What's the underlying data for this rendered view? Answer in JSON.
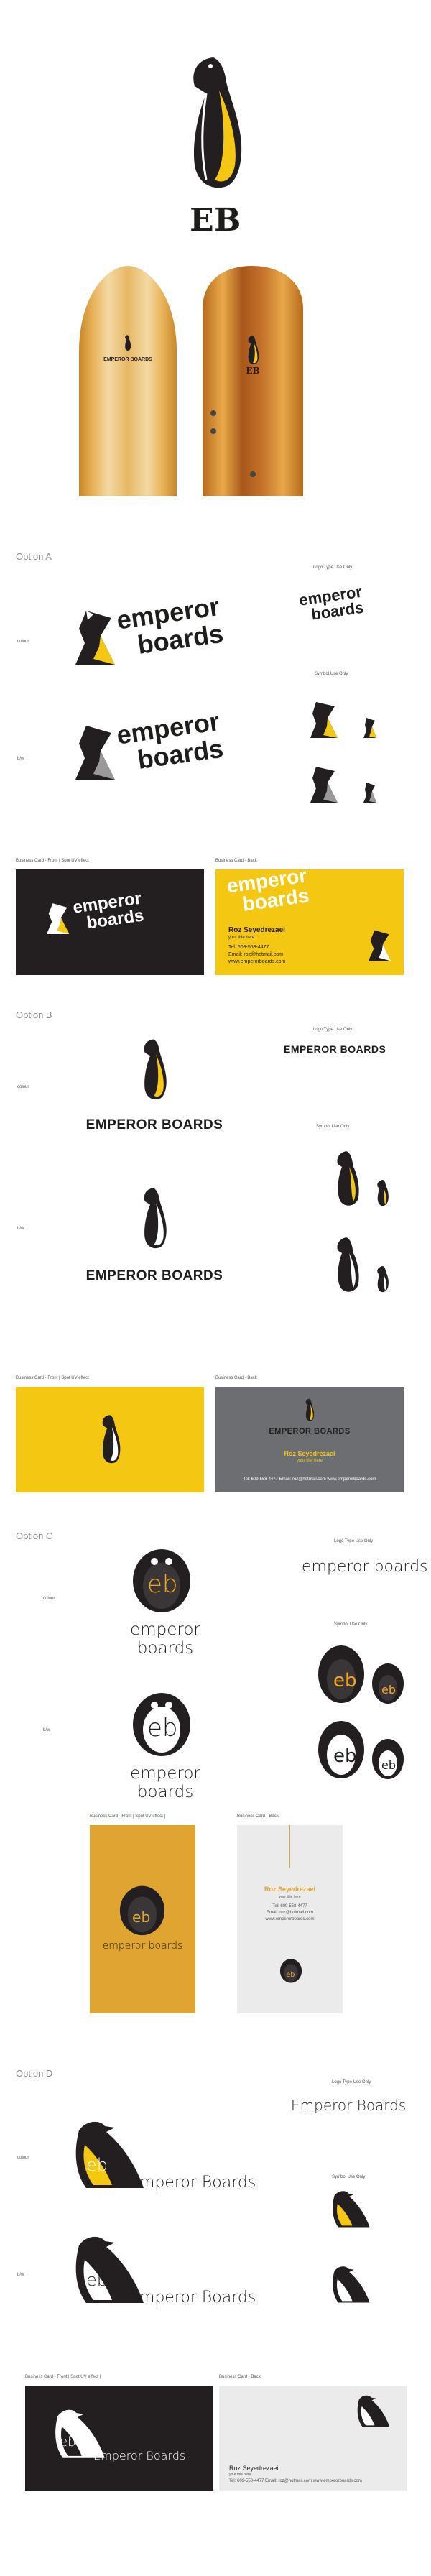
{
  "hero": {
    "monogram": "EB",
    "board_text": "EMPEROR BOARDS",
    "board_monogram": "EB"
  },
  "options": {
    "a": {
      "label": "Option A",
      "wordmark_line1": "emperor",
      "wordmark_line2": "boards",
      "logotype_caption": "Logo Type Use Only",
      "symbol_caption": "Symbol Use Only",
      "row1_caption": "colour",
      "row2_caption": "b/w",
      "card_front_caption": "Business Card - Front | Spot UV effect |",
      "card_back_caption": "Business Card - Back",
      "card_name": "Roz Seyedrezaei",
      "card_title": "your title here",
      "card_tel": "Tel: 609-558-4477",
      "card_email": "Email: roz@hotmail.com",
      "card_web": "www.emperorboards.com"
    },
    "b": {
      "label": "Option B",
      "wordmark": "EMPEROR BOARDS",
      "logotype_caption": "Logo Type Use Only",
      "symbol_caption": "Symbol Use Only",
      "row1_caption": "colour",
      "row2_caption": "b/w",
      "card_front_caption": "Business Card - Front | Spot UV effect |",
      "card_back_caption": "Business Card - Back",
      "card_name": "Roz Seyedrezaei",
      "card_title": "your title here",
      "card_contact": "Tel: 609-558-4477   Email: roz@hotmail.com   www.emperorboards.com"
    },
    "c": {
      "label": "Option C",
      "monogram": "eb",
      "wordmark": "emperor boards",
      "logotype_caption": "Logo Type Use Only",
      "symbol_caption": "Symbol Use Only",
      "row1_caption": "colour",
      "row2_caption": "b/w",
      "card_front_caption": "Business Card - Front | Spot UV effect |",
      "card_back_caption": "Business Card - Back",
      "card_name": "Roz Seyedrezaei",
      "card_title": "your title here",
      "card_tel": "Tel: 609-558-4477",
      "card_email": "Email: roz@hotmail.com",
      "card_web": "www.emperorboards.com"
    },
    "d": {
      "label": "Option D",
      "monogram": "eb",
      "wordmark": "Emperor Boards",
      "logotype_caption": "Logo Type Use Only",
      "symbol_caption": "Symbol Use Only",
      "row1_caption": "colour",
      "row2_caption": "b/w",
      "card_front_caption": "Business Card - Front | Spot UV effect |",
      "card_back_caption": "Business Card - Back",
      "card_name": "Roz Seyedrezaei",
      "card_title": "your title here",
      "card_contact": "Tel: 609-558-4477     Email: roz@hotmail.com     www.emperorboards.com"
    }
  },
  "colors": {
    "yellow": "#f4c712",
    "dark": "#231f20",
    "gray_card": "#6d6e71",
    "gold_card": "#e0a530"
  }
}
